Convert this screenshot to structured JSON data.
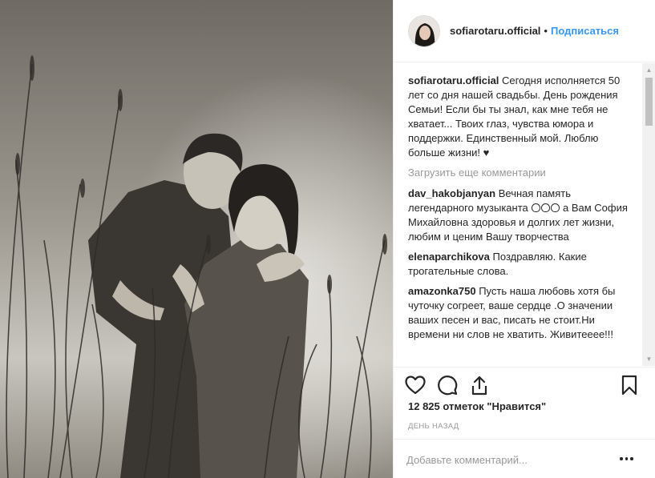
{
  "header": {
    "username": "sofiarotaru.official",
    "separator": "•",
    "follow_label": "Подписаться"
  },
  "caption": {
    "user": "sofiarotaru.official",
    "text": "Сегодня исполняется 50 лет со дня нашей свадьбы. День рождения Семьи! Если бы ты знал, как мне тебя не хватает... Твоих глаз, чувства юмора и поддержки. Единственный мой. Люблю больше жизни!",
    "heart": "♥"
  },
  "load_more_label": "Загрузить еще комментарии",
  "comments": [
    {
      "user": "dav_hakobjanyan",
      "text_before": "Вечная память легендарного музыканта",
      "emoji_count": 3,
      "text_after": "а Вам София Михайловна здоровья и долгих лет жизни, любим и ценим Вашу творчества"
    },
    {
      "user": "elenaparchikova",
      "text": "Поздравляю. Какие трогательные слова."
    },
    {
      "user": "amazonka750",
      "text": "Пусть наша любовь хотя бы чуточку согреет, ваше сердце .О значении ваших песен и вас, писать не стоит.Ни времени ни слов не хватить. Живитееее!!!"
    }
  ],
  "actions": {
    "like_icon": "heart-outline-icon",
    "comment_icon": "speech-bubble-icon",
    "share_icon": "share-upload-icon",
    "save_icon": "bookmark-icon"
  },
  "likes": {
    "count": "12 825",
    "label": "отметок \"Нравится\""
  },
  "timestamp": "ДЕНЬ НАЗАД",
  "add_comment": {
    "placeholder": "Добавьте комментарий..."
  },
  "colors": {
    "link": "#3897f0",
    "muted": "#999999",
    "text": "#262626",
    "border": "#efefef"
  }
}
